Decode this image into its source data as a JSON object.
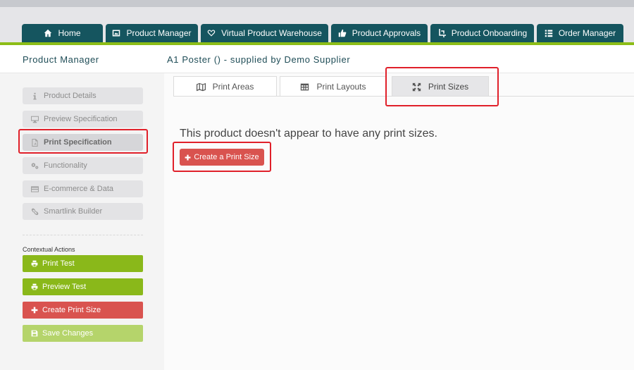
{
  "nav": {
    "tabs": [
      {
        "label": "Home",
        "icon": "home-icon"
      },
      {
        "label": "Product Manager",
        "icon": "image-icon"
      },
      {
        "label": "Virtual Product Warehouse",
        "icon": "heart-icon"
      },
      {
        "label": "Product Approvals",
        "icon": "thumbs-up-icon"
      },
      {
        "label": "Product Onboarding",
        "icon": "crop-icon"
      },
      {
        "label": "Order Manager",
        "icon": "list-icon"
      }
    ]
  },
  "header": {
    "section": "Product Manager",
    "product_title": "A1 Poster () - supplied by Demo Supplier"
  },
  "sidebar": {
    "items": [
      {
        "label": "Product Details",
        "icon": "info-icon"
      },
      {
        "label": "Preview Specification",
        "icon": "monitor-icon"
      },
      {
        "label": "Print Specification",
        "icon": "file-icon"
      },
      {
        "label": "Functionality",
        "icon": "cogs-icon"
      },
      {
        "label": "E-commerce & Data",
        "icon": "credit-card-icon"
      },
      {
        "label": "Smartlink Builder",
        "icon": "link-icon"
      }
    ],
    "contextual_label": "Contextual Actions",
    "actions": [
      {
        "label": "Print Test",
        "icon": "printer-icon"
      },
      {
        "label": "Preview Test",
        "icon": "printer-icon"
      },
      {
        "label": "Create Print Size",
        "icon": "plus-icon"
      },
      {
        "label": "Save Changes",
        "icon": "save-icon"
      }
    ]
  },
  "subtabs": [
    {
      "label": "Print Areas",
      "icon": "map-icon"
    },
    {
      "label": "Print Layouts",
      "icon": "table-icon"
    },
    {
      "label": "Print Sizes",
      "icon": "expand-icon"
    }
  ],
  "main": {
    "empty_message": "This product doesn't appear to have any print sizes.",
    "create_button": "Create a Print Size"
  },
  "colors": {
    "nav_tab": "#15555f",
    "accent_green": "#8cbd17",
    "danger_red": "#d9534f",
    "highlight": "#e0202a"
  }
}
